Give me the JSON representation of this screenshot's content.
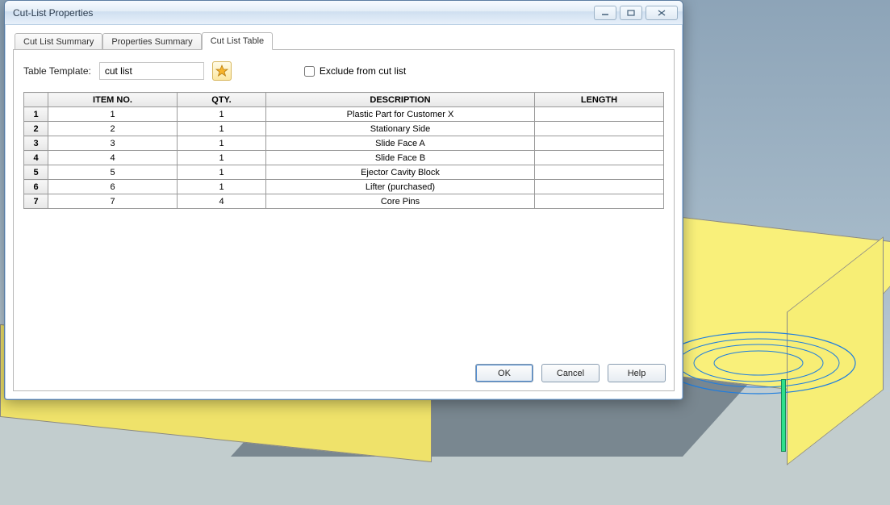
{
  "window": {
    "title": "Cut-List Properties"
  },
  "tabs": {
    "summary": "Cut List Summary",
    "properties": "Properties Summary",
    "table": "Cut List Table"
  },
  "template": {
    "label": "Table Template:",
    "value": "cut list",
    "icon": "star-icon"
  },
  "exclude": {
    "label": "Exclude from cut list"
  },
  "columns": {
    "item": "ITEM NO.",
    "qty": "QTY.",
    "desc": "DESCRIPTION",
    "len": "LENGTH"
  },
  "rows": [
    {
      "n": "1",
      "item": "1",
      "qty": "1",
      "desc": "Plastic Part for Customer X",
      "len": ""
    },
    {
      "n": "2",
      "item": "2",
      "qty": "1",
      "desc": "Stationary Side",
      "len": ""
    },
    {
      "n": "3",
      "item": "3",
      "qty": "1",
      "desc": "Slide Face A",
      "len": ""
    },
    {
      "n": "4",
      "item": "4",
      "qty": "1",
      "desc": "Slide Face B",
      "len": ""
    },
    {
      "n": "5",
      "item": "5",
      "qty": "1",
      "desc": "Ejector Cavity Block",
      "len": ""
    },
    {
      "n": "6",
      "item": "6",
      "qty": "1",
      "desc": "Lifter (purchased)",
      "len": ""
    },
    {
      "n": "7",
      "item": "7",
      "qty": "4",
      "desc": "Core Pins",
      "len": ""
    }
  ],
  "buttons": {
    "ok": "OK",
    "cancel": "Cancel",
    "help": "Help"
  }
}
